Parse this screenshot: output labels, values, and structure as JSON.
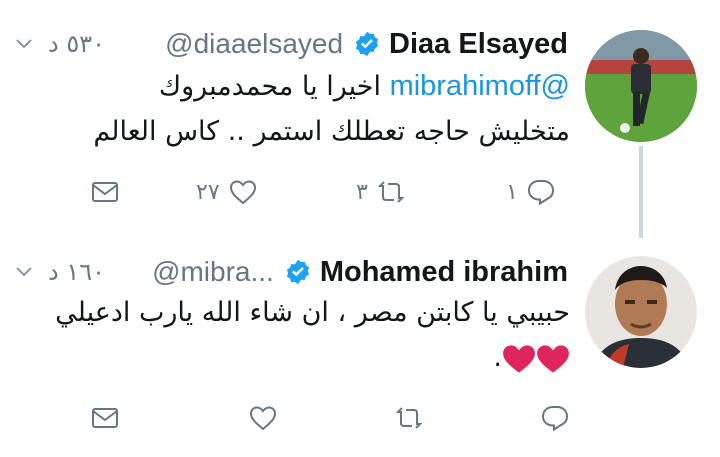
{
  "tweets": [
    {
      "name": "Diaa Elsayed",
      "handle": "@diaaelsayed",
      "time": "٥٣٠ د",
      "mention": "@mibrahimoff",
      "line1": " اخيرا يا محمدمبروك",
      "line2": "متخليش حاجه تعطلك استمر .. كاس العالم",
      "reply_count": "١",
      "retweet_count": "٣",
      "like_count": "٢٧"
    },
    {
      "name": "Mohamed ibrahim",
      "handle": "@mibra...",
      "time": "١٦٠ د",
      "line1": "حبيبي يا كابتن مصر ، ان شاء الله يارب ادعيلي",
      "line2": ".",
      "emoji": "heart-emoji x2",
      "reply_count": "",
      "retweet_count": "",
      "like_count": ""
    }
  ],
  "colors": {
    "link": "#1b95e0",
    "verified": "#1da1f2",
    "muted": "#657786",
    "heart": "#e0245e"
  },
  "icons": [
    "verified-badge-icon",
    "chevron-down-icon",
    "reply-icon",
    "retweet-icon",
    "like-icon",
    "mail-icon"
  ]
}
